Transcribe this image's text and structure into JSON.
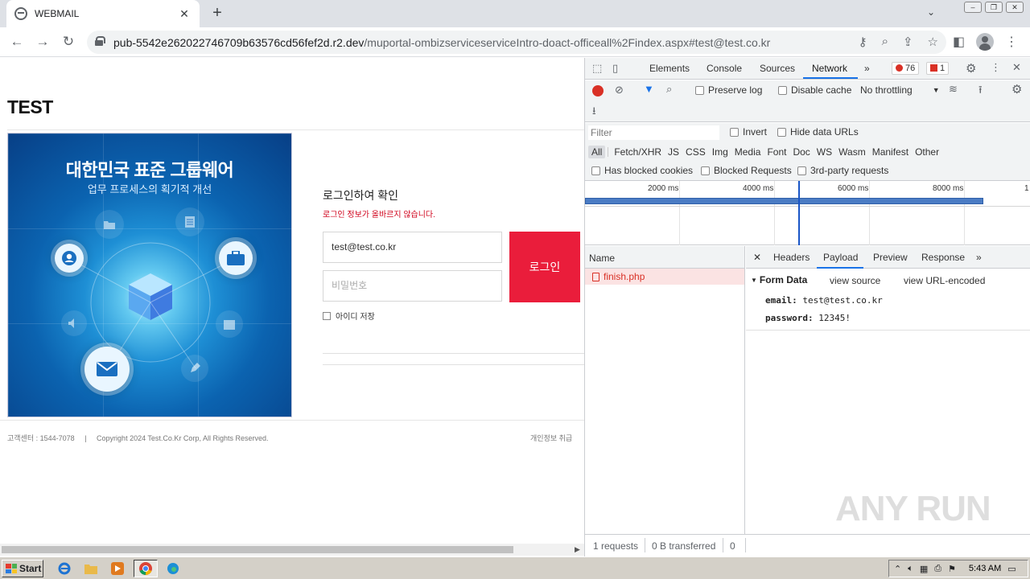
{
  "browser": {
    "tab_title": "WEBMAIL",
    "tab_close": "✕",
    "new_tab": "+",
    "url_host": "pub-5542e262022746709b63576cd56fef2d.r2.dev",
    "url_path": "/muportal-ombizserviceserviceIntro-doact-officeall%2Findex.aspx#test@test.co.kr"
  },
  "page": {
    "brand": "TEST",
    "banner": {
      "title": "대한민국 표준 그룹웨어",
      "subtitle": "업무 프로세스의 획기적 개선"
    },
    "login": {
      "title": "로그인하여 확인",
      "error": "로그인 정보가 올바르지 않습니다.",
      "email_value": "test@test.co.kr",
      "password_placeholder": "비밀번호",
      "button": "로그인",
      "save_id": "아이디 저장"
    },
    "footer": {
      "contact": "고객센터 : 1544-7078",
      "separator": "|",
      "copyright": "Copyright 2024 Test.Co.Kr Corp, All Rights Reserved.",
      "privacy": "개인정보 취급"
    }
  },
  "devtools": {
    "tabs": [
      "Elements",
      "Console",
      "Sources",
      "Network"
    ],
    "more": "»",
    "error_count": "76",
    "issue_count": "1",
    "toolbar": {
      "preserve_log": "Preserve log",
      "disable_cache": "Disable cache",
      "throttling": "No throttling"
    },
    "filter": {
      "placeholder": "Filter",
      "invert": "Invert",
      "hide_data_urls": "Hide data URLs",
      "types": [
        "All",
        "Fetch/XHR",
        "JS",
        "CSS",
        "Img",
        "Media",
        "Font",
        "Doc",
        "WS",
        "Wasm",
        "Manifest",
        "Other"
      ],
      "blocked_cookies": "Has blocked cookies",
      "blocked_requests": "Blocked Requests",
      "third_party": "3rd-party requests"
    },
    "timeline": {
      "ticks": [
        "2000 ms",
        "4000 ms",
        "6000 ms",
        "8000 ms",
        "1"
      ]
    },
    "requests": {
      "header": "Name",
      "rows": [
        "finish.php"
      ]
    },
    "detail": {
      "close": "✕",
      "tabs": [
        "Headers",
        "Payload",
        "Preview",
        "Response"
      ],
      "more": "»",
      "section": "Form Data",
      "view_source": "view source",
      "view_url_encoded": "view URL-encoded",
      "fields": [
        {
          "key": "email:",
          "value": "test@test.co.kr"
        },
        {
          "key": "password:",
          "value": "12345!"
        }
      ]
    },
    "status": {
      "requests": "1 requests",
      "transferred": "0 B transferred",
      "extra": "0"
    }
  },
  "watermark": "ANY RUN",
  "taskbar": {
    "start": "Start",
    "clock": "5:43 AM"
  }
}
